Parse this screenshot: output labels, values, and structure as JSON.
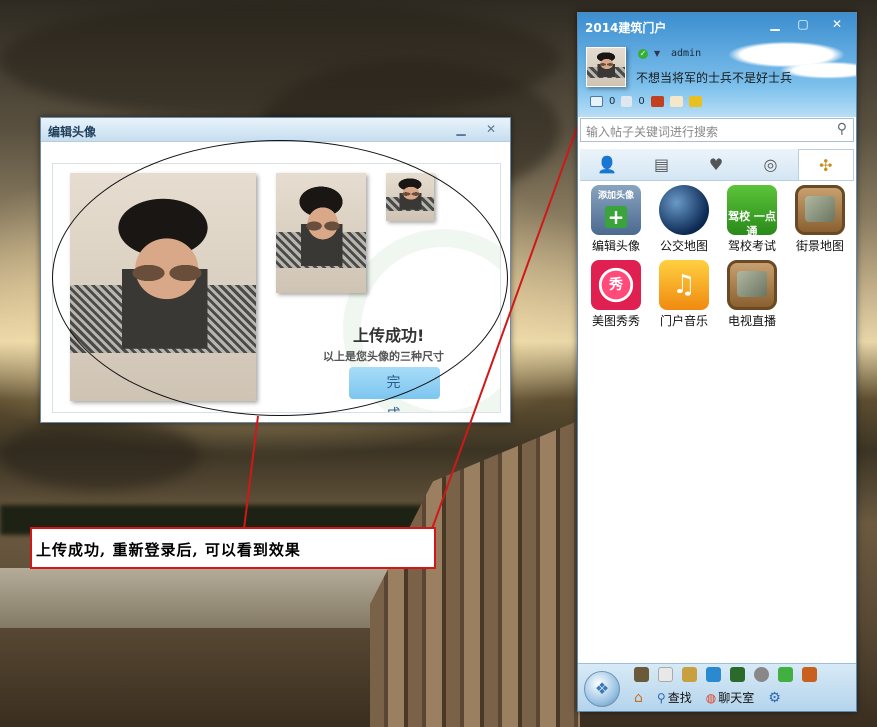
{
  "dialog": {
    "title": "编辑头像",
    "upload_success": "上传成功!",
    "sizes_hint": "以上是您头像的三种尺寸",
    "done_label": "完成"
  },
  "annotation": {
    "text": "上传成功, 重新登录后, 可以看到效果"
  },
  "panel": {
    "title": "2014建筑门户",
    "username": "admin",
    "signature": "不想当将军的士兵不是好士兵",
    "mail_count": "0",
    "sound_count": "0",
    "search_placeholder": "输入帖子关键词进行搜索",
    "tabs": [
      "contacts-icon",
      "notes-icon",
      "heart-icon",
      "compass-icon",
      "signpost-icon"
    ],
    "apps": [
      {
        "label": "编辑头像",
        "icon_text": "添加头像"
      },
      {
        "label": "公交地图",
        "icon_text": ""
      },
      {
        "label": "驾校考试",
        "icon_text": "驾校 一点通"
      },
      {
        "label": "街景地图",
        "icon_text": ""
      },
      {
        "label": "美图秀秀",
        "icon_text": "秀"
      },
      {
        "label": "门户音乐",
        "icon_text": "♫"
      },
      {
        "label": "电视直播",
        "icon_text": ""
      }
    ],
    "bottom": {
      "find_label": "查找",
      "chat_label": "聊天室"
    }
  }
}
